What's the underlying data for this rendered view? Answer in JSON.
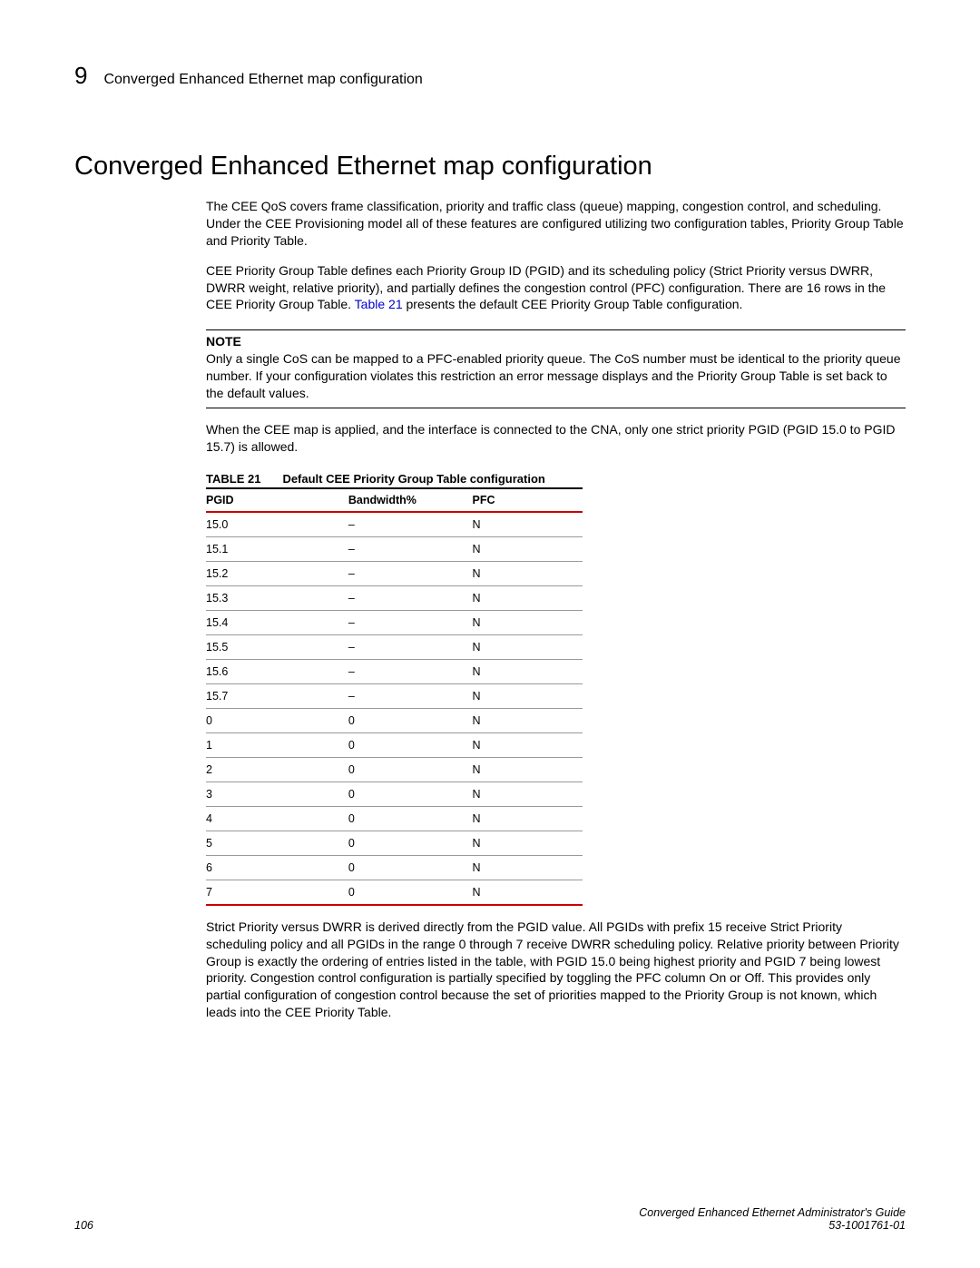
{
  "header": {
    "chapter_number": "9",
    "title": "Converged Enhanced Ethernet map configuration"
  },
  "main_title": "Converged Enhanced Ethernet map configuration",
  "paragraphs": {
    "p1": "The CEE QoS covers frame classification, priority and traffic class (queue) mapping, congestion control, and scheduling. Under the CEE Provisioning model all of these features are configured utilizing two configuration tables, Priority Group Table and Priority Table.",
    "p2_a": "CEE Priority Group Table defines each Priority Group ID (PGID) and its scheduling policy (Strict Priority versus DWRR, DWRR weight, relative priority), and partially defines the congestion control (PFC) configuration. There are 16 rows in the CEE Priority Group Table. ",
    "p2_link": "Table 21",
    "p2_b": " presents the default CEE Priority Group Table configuration.",
    "p4": "When the CEE map is applied, and the interface is connected to the CNA, only one strict priority PGID (PGID 15.0 to PGID 15.7) is allowed.",
    "p5": "Strict Priority versus DWRR is derived directly from the PGID value. All PGIDs with prefix 15 receive Strict Priority scheduling policy and all PGIDs in the range 0 through 7 receive DWRR scheduling policy. Relative priority between Priority Group is exactly the ordering of entries listed in the table, with PGID 15.0 being highest priority and PGID 7 being lowest priority. Congestion control configuration is partially specified by toggling the PFC column On or Off. This provides only partial configuration of congestion control because the set of priorities mapped to the Priority Group is not known, which leads into the CEE Priority Table."
  },
  "note": {
    "heading": "NOTE",
    "body": "Only a single CoS can be mapped to a PFC-enabled priority queue. The CoS number must be identical to the priority queue number. If your configuration violates this restriction an error message displays and the Priority Group Table is set back to the default values."
  },
  "table": {
    "label": "TABLE 21",
    "caption": "Default CEE Priority Group Table configuration",
    "headers": {
      "h1": "PGID",
      "h2": "Bandwidth%",
      "h3": "PFC"
    },
    "rows": [
      {
        "pgid": "15.0",
        "bw": "–",
        "pfc": "N"
      },
      {
        "pgid": "15.1",
        "bw": "–",
        "pfc": "N"
      },
      {
        "pgid": "15.2",
        "bw": "–",
        "pfc": "N"
      },
      {
        "pgid": "15.3",
        "bw": "–",
        "pfc": "N"
      },
      {
        "pgid": "15.4",
        "bw": "–",
        "pfc": "N"
      },
      {
        "pgid": "15.5",
        "bw": "–",
        "pfc": "N"
      },
      {
        "pgid": "15.6",
        "bw": "–",
        "pfc": "N"
      },
      {
        "pgid": "15.7",
        "bw": "–",
        "pfc": "N"
      },
      {
        "pgid": "0",
        "bw": "0",
        "pfc": "N"
      },
      {
        "pgid": "1",
        "bw": "0",
        "pfc": "N"
      },
      {
        "pgid": "2",
        "bw": "0",
        "pfc": "N"
      },
      {
        "pgid": "3",
        "bw": "0",
        "pfc": "N"
      },
      {
        "pgid": "4",
        "bw": "0",
        "pfc": "N"
      },
      {
        "pgid": "5",
        "bw": "0",
        "pfc": "N"
      },
      {
        "pgid": "6",
        "bw": "0",
        "pfc": "N"
      },
      {
        "pgid": "7",
        "bw": "0",
        "pfc": "N"
      }
    ]
  },
  "footer": {
    "page_num": "106",
    "guide": "Converged Enhanced Ethernet Administrator's Guide",
    "docnum": "53-1001761-01"
  }
}
